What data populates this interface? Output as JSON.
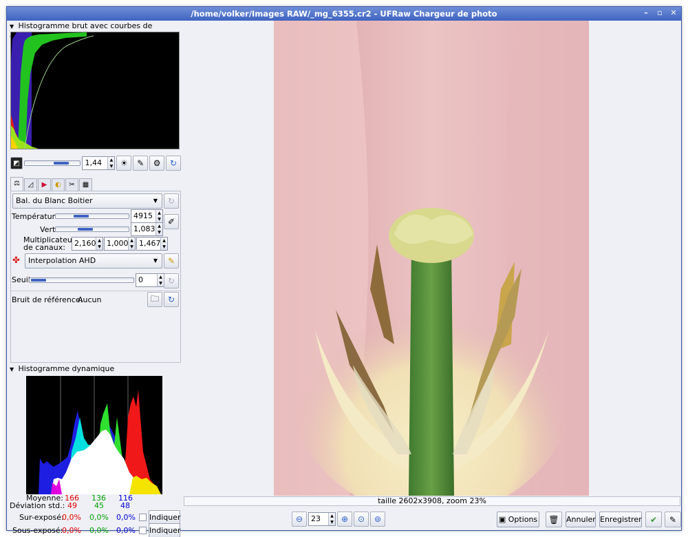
{
  "window": {
    "title": "/home/volker/Images RAW/_mg_6355.cr2 - UFRaw Chargeur de photo"
  },
  "raw_histogram": {
    "title": "Histogramme brut avec courbes de conversion"
  },
  "exposure": {
    "value": "1,44"
  },
  "tabs": [
    "base",
    "curve",
    "color",
    "lightness",
    "crop",
    "exif"
  ],
  "white_balance": {
    "preset": "Bal. du Blanc Boitier",
    "temperature_label": "Température",
    "temperature": "4915",
    "temperature_level": 0.35,
    "green_label": "Vert",
    "green": "1,083",
    "green_level": 0.35,
    "multipliers_label_1": "Multiplicateurs",
    "multipliers_label_2": "de canaux:",
    "multipliers": [
      "2,160",
      "1,000",
      "1,467"
    ]
  },
  "interpolation": {
    "value": "Interpolation AHD"
  },
  "threshold": {
    "label": "Seuil",
    "value": "0",
    "level": 0.0
  },
  "dark_frame": {
    "label": "Bruit de référence:",
    "value": "Aucun"
  },
  "dynamic_histogram": {
    "title": "Histogramme dynamique",
    "mean_label": "Moyenne:",
    "mean": [
      "166",
      "136",
      "116"
    ],
    "std_label": "Déviation std.:",
    "std": [
      "49",
      "45",
      "48"
    ],
    "over_label": "Sur-exposé:",
    "over": [
      "0,0%",
      "0,0%",
      "0,0%"
    ],
    "under_label": "Sous-exposé:",
    "under": [
      "0,0%",
      "0,0%",
      "0,0%"
    ],
    "indicate_label": "Indiquer"
  },
  "status": {
    "text": "taille 2602x3908, zoom 23%"
  },
  "zoom": {
    "value": "23"
  },
  "buttons": {
    "options": "Options",
    "cancel": "Annuler",
    "save": "Enregistrer"
  }
}
